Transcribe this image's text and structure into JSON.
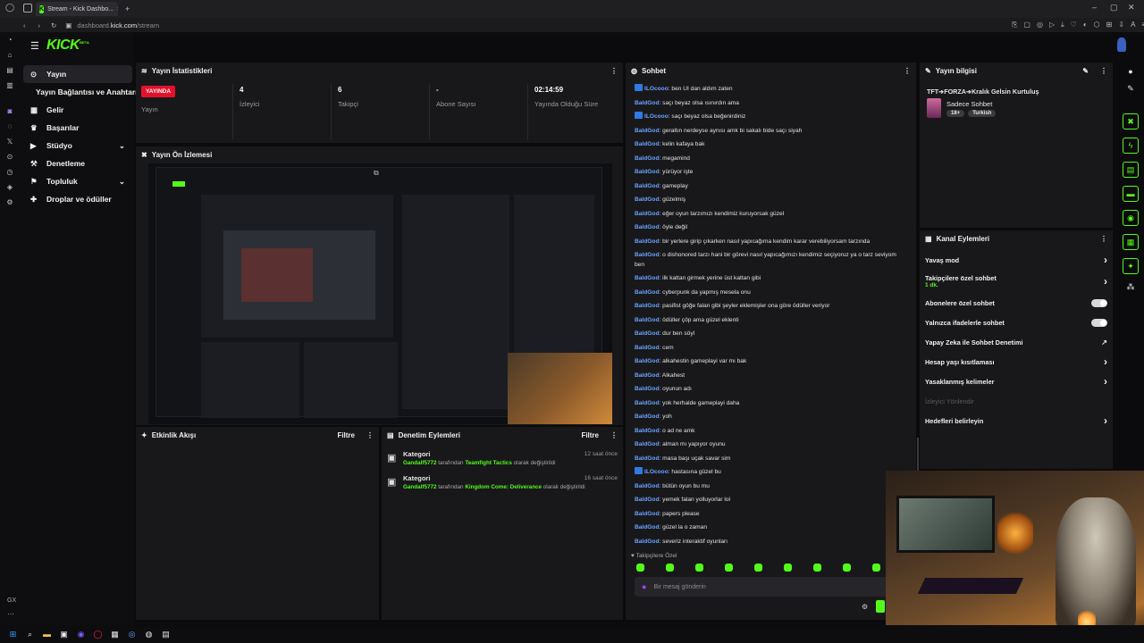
{
  "browser": {
    "tab_title": "Stream - Kick Dashbo...",
    "url_prefix": "dashboard.",
    "url_domain": "kick.com",
    "url_path": "/stream"
  },
  "brand": {
    "logo": "KICK",
    "beta": "BETA",
    "accent": "#53fc18",
    "live_red": "#e5112a"
  },
  "sidebar": {
    "items": [
      {
        "label": "Yayın",
        "icon": "broadcast-icon",
        "active": true
      },
      {
        "label": "Yayın Bağlantısı ve Anahtarı",
        "icon": ""
      },
      {
        "label": "Gelir",
        "icon": "chart-icon"
      },
      {
        "label": "Başarılar",
        "icon": "trophy-icon"
      },
      {
        "label": "Stüdyo",
        "icon": "studio-icon",
        "expandable": true
      },
      {
        "label": "Denetleme",
        "icon": "hammer-icon"
      },
      {
        "label": "Topluluk",
        "icon": "community-icon",
        "expandable": true
      },
      {
        "label": "Droplar ve ödüller",
        "icon": "gift-icon"
      }
    ],
    "footer": "GX"
  },
  "stats": {
    "title": "Yayın İstatistikleri",
    "live_badge": "YAYINDA",
    "items": [
      {
        "value": "",
        "label": "Yayın"
      },
      {
        "value": "4",
        "label": "İzleyici"
      },
      {
        "value": "6",
        "label": "Takipçi"
      },
      {
        "value": "-",
        "label": "Abone Sayısı"
      },
      {
        "value": "02:14:59",
        "label": "Yayında Olduğu Süre"
      }
    ]
  },
  "preview": {
    "title": "Yayın Ön İzlemesi"
  },
  "activity": {
    "title": "Etkinlik Akışı",
    "filter": "Filtre"
  },
  "moderation": {
    "title": "Denetim Eylemleri",
    "filter": "Filtre",
    "items": [
      {
        "title": "Kategori",
        "user": "Gandalf5772",
        "middle": " tarafından ",
        "category": "Teamfight Tactics",
        "suffix": " olarak değiştirildi",
        "time": "12 saat önce"
      },
      {
        "title": "Kategori",
        "user": "Gandalf5772",
        "middle": " tarafından ",
        "category": "Kingdom Come: Deliverance",
        "suffix": " olarak değiştirildi",
        "time": "16 saat önce"
      }
    ]
  },
  "chat": {
    "title": "Sohbet",
    "followers_only": "Takipçilere Özel",
    "placeholder": "Bir mesaj gönderin",
    "messages": [
      {
        "user": "ILOcooo",
        "text": "ben UI dan aldım zaten",
        "badge": true
      },
      {
        "user": "BaldGod",
        "text": "saçı beyaz olsa ısınırdın ama"
      },
      {
        "user": "ILOcooo",
        "text": "saçı beyaz olsa beğenirdiniz",
        "badge": true
      },
      {
        "user": "BaldGod",
        "text": "geraltın nerdeyse aynısı amk bi sakalı bide saçı siyah"
      },
      {
        "user": "BaldGod",
        "text": "kelin kafaya bak"
      },
      {
        "user": "BaldGod",
        "text": "megamind"
      },
      {
        "user": "BaldGod",
        "text": "yürüyor işte"
      },
      {
        "user": "BaldGod",
        "text": "gameplay"
      },
      {
        "user": "BaldGod",
        "text": "güzelmiş"
      },
      {
        "user": "BaldGod",
        "text": "eğer oyun tarzımızı kendimiz kuruyorsak güzel"
      },
      {
        "user": "BaldGod",
        "text": "öyle değil"
      },
      {
        "user": "BaldGod",
        "text": "bir yerlere girip çıkarken nasıl yapıcağıma kendim karar verebiliyorsam tarzında"
      },
      {
        "user": "BaldGod",
        "text": "o dishonored tarzı hani bir görevi nasıl yapıcağımızı kendimiz seçiyoruz ya o tarz seviyom",
        "cont": "ben"
      },
      {
        "user": "BaldGod",
        "text": "ilk kattan girmek yerine üst kattan gibi"
      },
      {
        "user": "BaldGod",
        "text": "cyberpunk da yapmış mesela onu"
      },
      {
        "user": "BaldGod",
        "text": "pasifist göğe falan gibi şeyler eklemişler ona göre ödüller veriyor"
      },
      {
        "user": "BaldGod",
        "text": "ödüller çöp ama güzel eklenti"
      },
      {
        "user": "BaldGod",
        "text": "dur ben söyl"
      },
      {
        "user": "BaldGod",
        "text": "cem"
      },
      {
        "user": "BaldGod",
        "text": "alkahestin gameplayi var mı bak"
      },
      {
        "user": "BaldGod",
        "text": "Alkahest"
      },
      {
        "user": "BaldGod",
        "text": "oyunun adı"
      },
      {
        "user": "BaldGod",
        "text": "yok herhalde gameplayi daha"
      },
      {
        "user": "BaldGod",
        "text": "yoh"
      },
      {
        "user": "BaldGod",
        "text": "o ad ne amk"
      },
      {
        "user": "BaldGod",
        "text": "alman mı yapıyor oyunu"
      },
      {
        "user": "BaldGod",
        "text": "masa başı uçak savar sim"
      },
      {
        "user": "ILOcooo",
        "text": "hastasına güzel bu",
        "badge": true
      },
      {
        "user": "BaldGod",
        "text": "bütün oyun bu mu"
      },
      {
        "user": "BaldGod",
        "text": "yemek falan yolluyorlar lol"
      },
      {
        "user": "BaldGod",
        "text": "papers please"
      },
      {
        "user": "BaldGod",
        "text": "güzel la o zaman"
      },
      {
        "user": "BaldGod",
        "text": "severiz interaktif oyunları"
      }
    ]
  },
  "stream_info": {
    "title": "Yayın bilgisi",
    "stream_title": "TFT➔FORZA➔Kralık Gelsin Kurtuluş",
    "category": "Sadece Sohbet",
    "tags": [
      "18+",
      "Turkish"
    ]
  },
  "channel_actions": {
    "title": "Kanal Eylemleri",
    "items": [
      {
        "label": "Yavaş mod",
        "control": "chevron"
      },
      {
        "label": "Takipçilere özel sohbet",
        "sub": "1 dk.",
        "control": "chevron"
      },
      {
        "label": "Abonelere özel sohbet",
        "control": "toggle"
      },
      {
        "label": "Yalnızca ifadelerle sohbet",
        "control": "toggle"
      },
      {
        "label": "Yapay Zeka ile Sohbet Denetimi",
        "control": "external"
      },
      {
        "label": "Hesap yaşı kısıtlaması",
        "control": "chevron"
      },
      {
        "label": "Yasaklanmış kelimeler",
        "control": "chevron"
      },
      {
        "label": "İzleyici Yönlendir",
        "control": "none",
        "disabled": true
      },
      {
        "label": "Hedefleri belirleyin",
        "control": "chevron"
      }
    ]
  }
}
